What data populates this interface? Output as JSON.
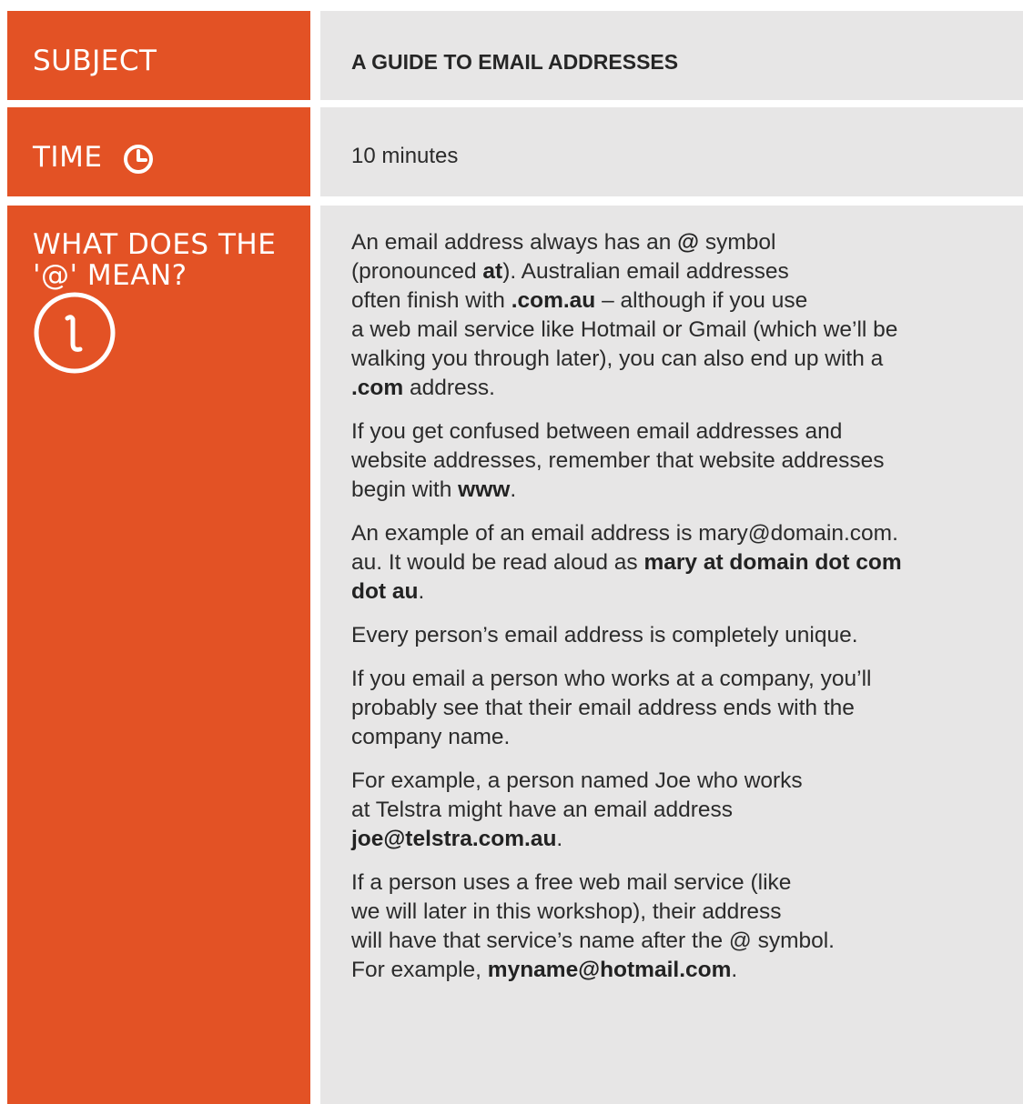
{
  "subject": {
    "label": "SUBJECT",
    "title": "A GUIDE TO EMAIL ADDRESSES"
  },
  "time": {
    "label": "TIME",
    "value": "10 minutes",
    "icon": "clock-icon"
  },
  "what": {
    "label_line1": "WHAT DOES THE",
    "label_line2": "'@' MEAN?",
    "icon": "info-icon",
    "p1": {
      "t1": "An email address always has an ",
      "b1": "@",
      "t2": " symbol",
      "t3": "(pronounced ",
      "b2": "at",
      "t4": "). Australian email addresses",
      "t5": "often finish with ",
      "b3": ".com.au",
      "t6": " – although if you use",
      "t7": "a web mail service like Hotmail or Gmail (which we’ll be",
      "t8": "walking you through later), you can also end up with a",
      "b4": ".com",
      "t9": " address."
    },
    "p2": {
      "t1": "If you get confused between email addresses and",
      "t2": "website addresses, remember that website addresses",
      "t3": "begin with ",
      "b1": "www",
      "t4": "."
    },
    "p3": {
      "t1": "An example of an email address is mary@domain.com.",
      "t2": "au. It would be read aloud as ",
      "b1": "mary at domain dot com",
      "b2": "dot au",
      "t3": "."
    },
    "p4": "Every person’s email address is completely unique.",
    "p5": {
      "t1": "If you email a person who works at a company, you’ll",
      "t2": "probably see that their email address ends with the",
      "t3": "company name."
    },
    "p6": {
      "t1": "For example, a person named Joe who works",
      "t2": "at Telstra might have an email address",
      "b1": "joe@telstra.com.au",
      "t3": "."
    },
    "p7": {
      "t1": "If a person uses a free web mail service (like",
      "t2": "we will later in this workshop), their address",
      "t3": "will have that service’s name after the @ symbol.",
      "t4": "For example, ",
      "b1": "myname@hotmail.com",
      "t5": "."
    }
  },
  "colors": {
    "accent": "#e35225",
    "panel": "#e7e6e6",
    "text": "#2b2b2b"
  }
}
